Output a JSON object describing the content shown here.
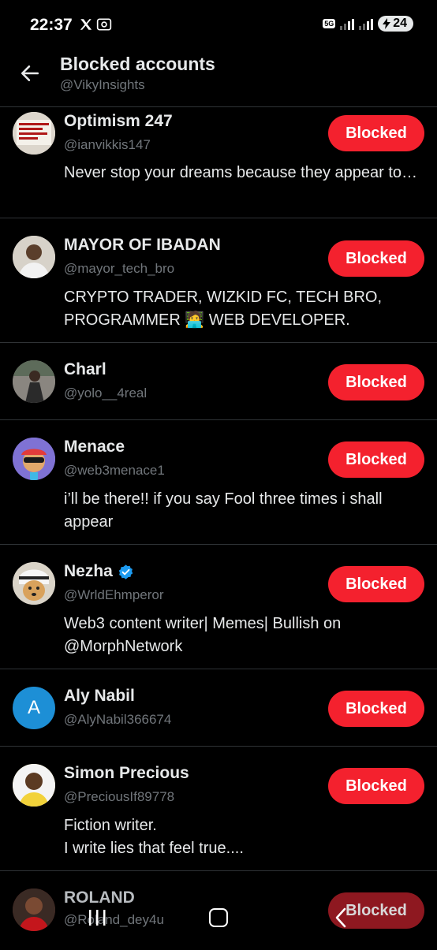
{
  "status": {
    "time": "22:37",
    "network": "5G",
    "battery": "24"
  },
  "header": {
    "title": "Blocked accounts",
    "subtitle": "@VikyInsights"
  },
  "accounts": [
    {
      "name": "Optimism 247",
      "handle": "@ianvikkis147",
      "bio": "Never stop your dreams because they appear too big to others. Keep pushing and keep wo...",
      "button": "Blocked",
      "avatar_text": "NIGERIA IS A PRISM THAT PRAYERS CANNOT FIX"
    },
    {
      "name": "MAYOR OF IBADAN",
      "handle": "@mayor_tech_bro",
      "bio": "CRYPTO TRADER, WIZKID FC, TECH BRO, PROGRAMMER 🧑‍💻 WEB DEVELOPER.",
      "button": "Blocked"
    },
    {
      "name": "Charl",
      "handle": "@yolo__4real",
      "bio": "",
      "button": "Blocked"
    },
    {
      "name": "Menace",
      "handle": "@web3menace1",
      "bio": "i’ll be there!! if you say Fool three times i shall appear",
      "button": "Blocked"
    },
    {
      "name": "Nezha",
      "handle": "@WrldEhmperor",
      "bio": "Web3 content writer| Memes| Bullish on @MorphNetwork",
      "button": "Blocked",
      "verified": true
    },
    {
      "name": "Aly Nabil",
      "handle": "@AlyNabil366674",
      "bio": "",
      "button": "Blocked",
      "avatar_letter": "A"
    },
    {
      "name": "Simon Precious",
      "handle": "@PreciousIf89778",
      "bio": "Fiction writer.\nI write lies that feel true....",
      "button": "Blocked"
    },
    {
      "name": "ROLAND",
      "handle": "@Roland_dey4u",
      "bio": "",
      "button": "Blocked"
    }
  ],
  "colors": {
    "background": "#000000",
    "blocked_button": "#f4212e",
    "secondary_text": "#71767b",
    "verified": "#1d9bf0"
  }
}
